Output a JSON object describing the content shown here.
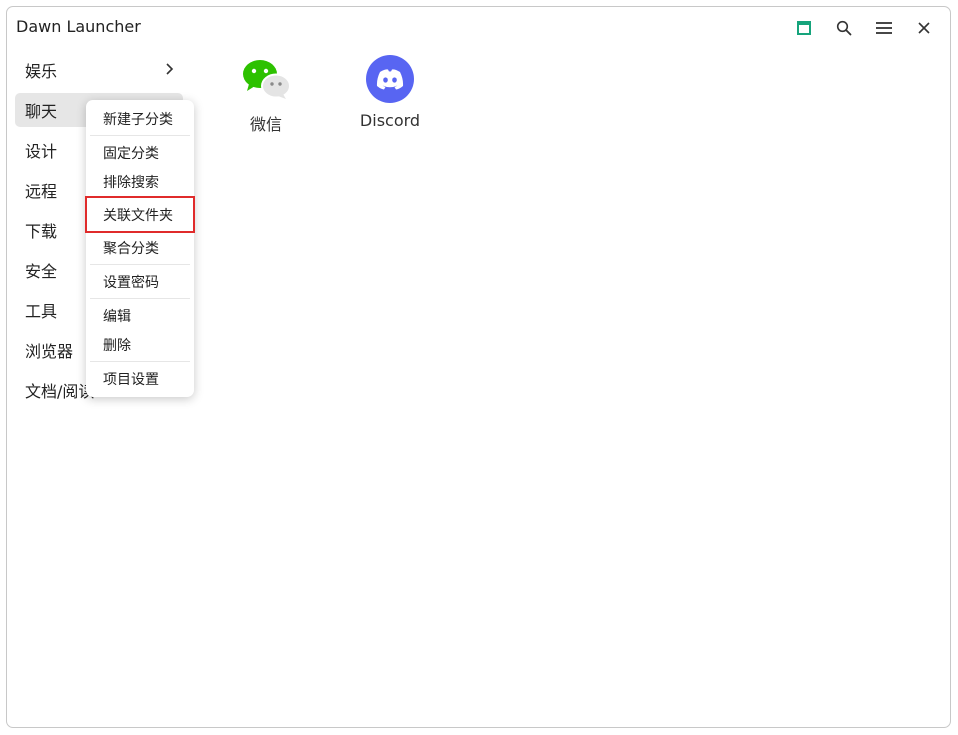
{
  "window": {
    "title": "Dawn Launcher"
  },
  "titlebar": {
    "buttons": [
      {
        "name": "window-icon",
        "color": "#16a47c"
      },
      {
        "name": "search-icon"
      },
      {
        "name": "menu-icon"
      },
      {
        "name": "close-icon"
      }
    ]
  },
  "sidebar": {
    "items": [
      {
        "label": "娱乐",
        "has_children": true
      },
      {
        "label": "聊天",
        "active": true
      },
      {
        "label": "设计"
      },
      {
        "label": "远程"
      },
      {
        "label": "下载"
      },
      {
        "label": "安全"
      },
      {
        "label": "工具"
      },
      {
        "label": "浏览器"
      },
      {
        "label": "文档/阅读"
      }
    ]
  },
  "apps": [
    {
      "label": "微信",
      "icon": "wechat-icon",
      "color": "#2dc100"
    },
    {
      "label": "Discord",
      "icon": "discord-icon",
      "color": "#5865f2"
    }
  ],
  "context_menu": {
    "items": [
      {
        "label": "新建子分类"
      },
      {
        "label": "固定分类"
      },
      {
        "label": "排除搜索"
      },
      {
        "label": "关联文件夹",
        "highlighted": true
      },
      {
        "label": "聚合分类"
      },
      {
        "label": "设置密码"
      },
      {
        "label": "编辑"
      },
      {
        "label": "删除"
      },
      {
        "label": "项目设置"
      }
    ],
    "highlight_color": "#e02b2b"
  }
}
